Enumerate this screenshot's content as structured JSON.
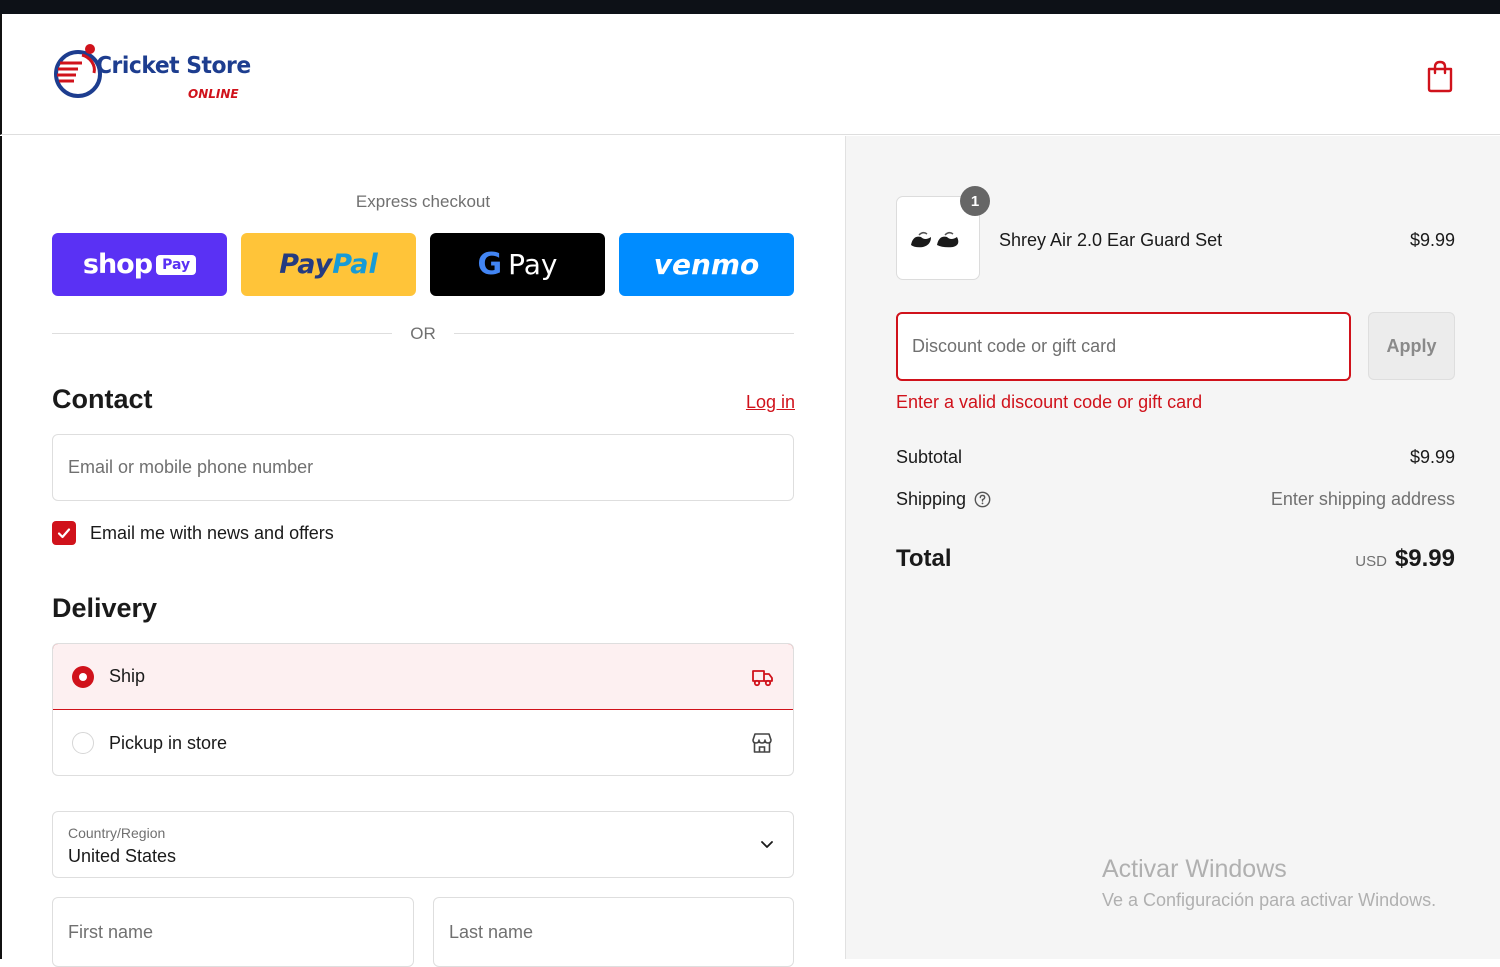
{
  "store": {
    "name": "Cricket Store",
    "tagline": "ONLINE"
  },
  "express": {
    "title": "Express checkout",
    "shop_pay": {
      "word": "shop",
      "badge": "Pay"
    },
    "paypal": {
      "a": "Pay",
      "b": "Pal"
    },
    "gpay": {
      "g": "G",
      "text": "Pay"
    },
    "venmo": "venmo",
    "or": "OR"
  },
  "contact": {
    "heading": "Contact",
    "login": "Log in",
    "email_placeholder": "Email or mobile phone number",
    "newsletter_label": "Email me with news and offers"
  },
  "delivery": {
    "heading": "Delivery",
    "options": [
      {
        "label": "Ship",
        "selected": true
      },
      {
        "label": "Pickup in store",
        "selected": false
      }
    ],
    "country_caption": "Country/Region",
    "country_value": "United States",
    "first_name_placeholder": "First name",
    "last_name_placeholder": "Last name"
  },
  "order": {
    "item": {
      "name": "Shrey Air 2.0 Ear Guard Set",
      "price": "$9.99",
      "quantity": "1"
    },
    "discount_placeholder": "Discount code or gift card",
    "apply_label": "Apply",
    "discount_error": "Enter a valid discount code or gift card",
    "subtotal_label": "Subtotal",
    "subtotal_value": "$9.99",
    "shipping_label": "Shipping",
    "shipping_value": "Enter shipping address",
    "total_label": "Total",
    "total_currency": "USD",
    "total_value": "$9.99"
  },
  "watermark": {
    "title": "Activar Windows",
    "subtitle": "Ve a Configuración para activar Windows."
  },
  "colors": {
    "accent": "#d0121b",
    "shop_pay": "#5a31f4",
    "paypal": "#ffc439",
    "venmo": "#008cff"
  }
}
